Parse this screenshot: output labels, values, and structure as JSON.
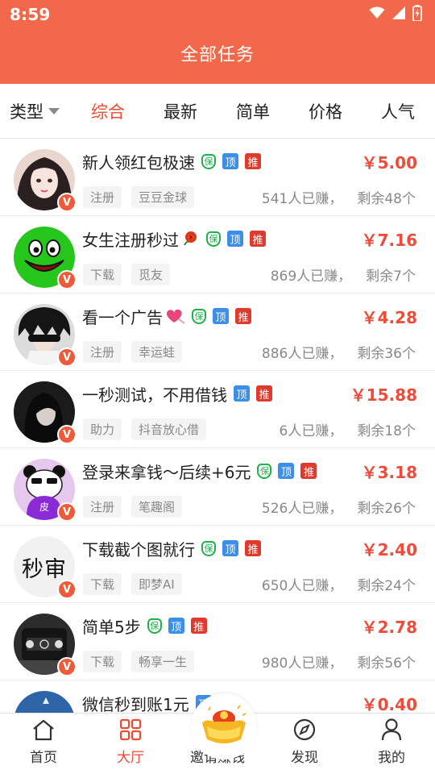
{
  "status_bar": {
    "time": "8:59"
  },
  "header": {
    "title": "全部任务"
  },
  "filters": {
    "type_label": "类型",
    "tabs": [
      {
        "label": "综合",
        "active": true
      },
      {
        "label": "最新",
        "active": false
      },
      {
        "label": "简单",
        "active": false
      },
      {
        "label": "价格",
        "active": false
      },
      {
        "label": "人气",
        "active": false
      }
    ]
  },
  "tag_labels": {
    "bao": "保",
    "ding": "顶",
    "tui": "推",
    "vip": "V"
  },
  "tasks": [
    {
      "title": "新人领红包极速",
      "emoji": "",
      "type": "注册",
      "app": "豆豆金球",
      "price": "￥5.00",
      "earned": "541人已赚，",
      "remaining": "剩余48个",
      "tags": [
        "bao",
        "ding",
        "tui"
      ]
    },
    {
      "title": "女生注册秒过",
      "emoji": "rose-icon",
      "type": "下载",
      "app": "觅友",
      "price": "￥7.16",
      "earned": "869人已赚，",
      "remaining": "剩余7个",
      "tags": [
        "bao",
        "ding",
        "tui"
      ]
    },
    {
      "title": "看一个广告",
      "emoji": "heart-icon",
      "type": "注册",
      "app": "幸运蛙",
      "price": "￥4.28",
      "earned": "886人已赚，",
      "remaining": "剩余36个",
      "tags": [
        "bao",
        "ding",
        "tui"
      ]
    },
    {
      "title": "一秒测试，不用借钱",
      "emoji": "",
      "type": "助力",
      "app": "抖音放心借",
      "price": "￥15.88",
      "earned": "6人已赚，",
      "remaining": "剩余18个",
      "tags": [
        "ding",
        "tui"
      ]
    },
    {
      "title": "登录来拿钱～后续+6元",
      "emoji": "",
      "type": "注册",
      "app": "笔趣阁",
      "price": "￥3.18",
      "earned": "526人已赚，",
      "remaining": "剩余26个",
      "tags": [
        "bao",
        "ding",
        "tui"
      ]
    },
    {
      "title": "下载截个图就行",
      "emoji": "",
      "type": "下载",
      "app": "即梦AI",
      "price": "￥2.40",
      "earned": "650人已赚，",
      "remaining": "剩余24个",
      "tags": [
        "bao",
        "ding",
        "tui"
      ],
      "avatar_text": "秒审"
    },
    {
      "title": "简单5步",
      "emoji": "",
      "type": "下载",
      "app": "畅享一生",
      "price": "￥2.78",
      "earned": "980人已赚，",
      "remaining": "剩余56个",
      "tags": [
        "bao",
        "ding",
        "tui"
      ]
    },
    {
      "title": "微信秒到账1元",
      "emoji": "",
      "type": "",
      "app": "",
      "price": "￥0.40",
      "earned": "",
      "remaining": "",
      "tags": [
        "ding",
        "tui"
      ]
    }
  ],
  "tabbar": {
    "items": [
      {
        "label": "首页",
        "icon": "home-icon",
        "active": false
      },
      {
        "label": "大厅",
        "icon": "grid-icon",
        "active": true
      },
      {
        "label": "邀请赚钱",
        "icon": "gold-ingot-icon",
        "active": false
      },
      {
        "label": "发现",
        "icon": "compass-icon",
        "active": false
      },
      {
        "label": "我的",
        "icon": "person-icon",
        "active": false
      }
    ]
  },
  "colors": {
    "brand": "#f2684a",
    "accent": "#ef4b34",
    "price": "#ef4b3a"
  }
}
